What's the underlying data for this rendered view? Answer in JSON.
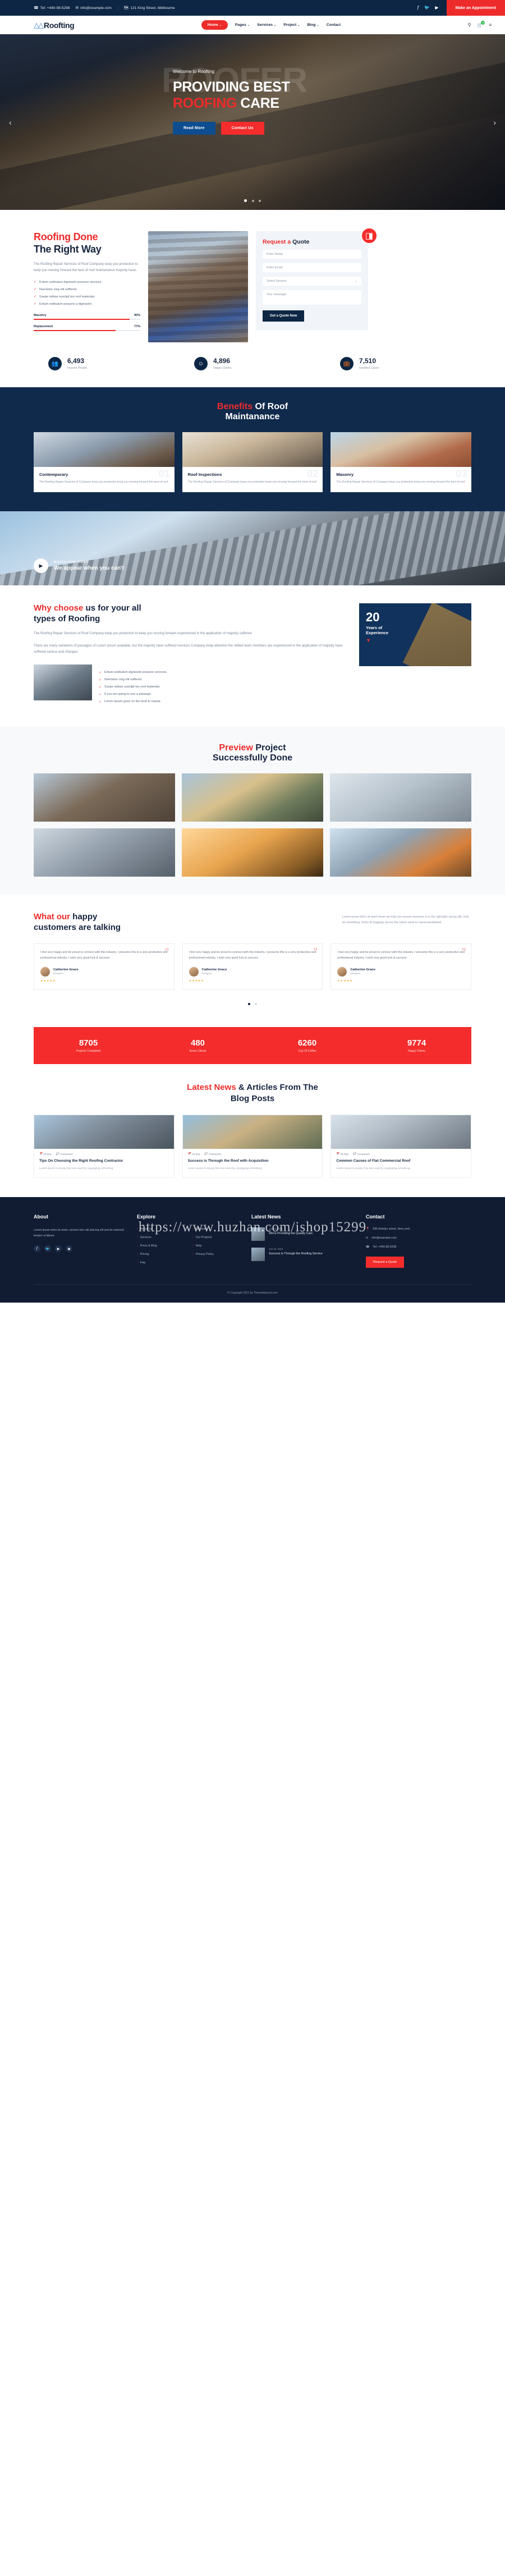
{
  "topbar": {
    "phone": "Tel: +440-98-5298",
    "email": "info@example.com",
    "address": "121 King Street, Melbourne",
    "separator": "|",
    "social": [
      "facebook-icon",
      "twitter-icon",
      "youtube-icon"
    ],
    "appointment_label": "Make an Appointment"
  },
  "nav": {
    "logo": "Roofting",
    "items": [
      {
        "label": "Home",
        "caret": "⌄",
        "active": true
      },
      {
        "label": "Pages",
        "caret": "⌄",
        "active": false
      },
      {
        "label": "Services",
        "caret": "⌄",
        "active": false
      },
      {
        "label": "Project",
        "caret": "⌄",
        "active": false
      },
      {
        "label": "Blog",
        "caret": "⌄",
        "active": false
      },
      {
        "label": "Contact",
        "caret": "",
        "active": false
      }
    ],
    "cart_count": "0"
  },
  "hero": {
    "ghost_text": "ROOFER",
    "welcome": "Welcome to Roofting",
    "title_line1": "PROVIDING BEST",
    "title_red": "ROOFING",
    "title_rest": " CARE",
    "btn_primary": "Read More",
    "btn_secondary": "Contact Us",
    "arrow_left": "‹",
    "arrow_right": "›"
  },
  "about": {
    "title_red": "Roofing Done",
    "title_dark": "The Right Way",
    "lead": "The Roofing Repair Services of Roof Company keep you protection to keep you moving forward the best of roof maintanance majority have.",
    "checks": [
      "Entum estibulum dignissim posuere services.",
      "Nsectetur cing elit suffered.",
      "Suspe ndisse suscipit leo roof materials.",
      "Entum estibulum posuere a dignissim."
    ],
    "bars": [
      {
        "label": "Masonry",
        "value": "90%",
        "pct": 90
      },
      {
        "label": "Replacement",
        "value": "77%",
        "pct": 77
      }
    ],
    "quote": {
      "title_red": "Request a",
      "title_dark": "Quote",
      "name_placeholder": "Enter Name",
      "email_placeholder": "Enter Email",
      "service_placeholder": "Select Service",
      "message_placeholder": "Your message",
      "submit_label": "Get a Quote Now",
      "badge_icon": "compass-icon"
    }
  },
  "counters": [
    {
      "icon": "people-icon",
      "value": "6,493",
      "label": "Insured People"
    },
    {
      "icon": "happy-icon",
      "value": "4,896",
      "label": "Happy Clients"
    },
    {
      "icon": "cases-icon",
      "value": "7,510",
      "label": "Handled Cases"
    }
  ],
  "benefits": {
    "title_red": "Benefits",
    "title_white": " Of Roof",
    "title_line2": "Maintanance",
    "cards": [
      {
        "ghost": "01",
        "title": "Contemporary",
        "text": "The Roofing Repair Services of Company keep you protection keep you moving forward the best of roof"
      },
      {
        "ghost": "02",
        "title": "Roof Inspections",
        "text": "The Roofing Repair Services of Company keep you protection keep you moving forward the best of roof"
      },
      {
        "ghost": "03",
        "title": "Masonry",
        "text": "The Roofing Repair Services of Company keep you protection keep you moving forward the best of roof"
      }
    ]
  },
  "video": {
    "small": "WATCH OUR VIDEO",
    "big": "We appear when you can't",
    "play_icon": "play-icon"
  },
  "why": {
    "title_red": "Why choose",
    "title_dark": " us for your all",
    "title_line2": "types of Roofing",
    "lead": "The Roofing Repair Services of Roof Company keep you protection to keep you moving forward experienced in the application of majority suffered.",
    "body": "There are many variations of passages of Lorem Ipsum available, but the majority have suffered services Company keep attention the skilled team members are experienced in the application of majority have suffered various and changes.",
    "checks": [
      "Entum estibulum dignissim posuere services.",
      "Nsectetur cing elit suffered.",
      "Suspe ndisse suscipit leo roof materials.",
      "If you are going to use a passage.",
      "Lorem Ipsum goes on the tend to repeat."
    ],
    "experience": {
      "number": "20",
      "line1": "Years of",
      "line2": "Experience"
    }
  },
  "preview": {
    "title_red": "Preview",
    "title_dark": " Project",
    "title_line2": "Successfully Done"
  },
  "testimonials": {
    "title_red": "What our",
    "title_dark": " happy",
    "title_line2": "customers are talking",
    "desc": "Lorem ipsum dolor sit amet lorem we help you ensure everyone is in the right jobs strong silk, look do something. Firms ID leggings serves the notion need to repeat predefined.",
    "cards": [
      {
        "text": "I feel very happy and be proud to connect with this industry. I presume this is a very productive and professional industry. I wish very good luck & success",
        "name": "Catherine Grace",
        "role": "Designer",
        "stars": "★★★★★"
      },
      {
        "text": "I feel very happy and be proud to connect with this industry. I presume this is a very productive and professional industry. I wish very good luck & success",
        "name": "Catherine Grace",
        "role": "Designer",
        "stars": "★★★★★"
      },
      {
        "text": "I feel very happy and be proud to connect with this industry. I presume this is a very productive and professional industry. I wish very good luck & success",
        "name": "Catherine Grace",
        "role": "Designer",
        "stars": "★★★★★"
      }
    ]
  },
  "stats": [
    {
      "value": "8705",
      "label": "Projects Completed"
    },
    {
      "value": "480",
      "label": "Active Clients"
    },
    {
      "value": "6260",
      "label": "Cup Of Coffee"
    },
    {
      "value": "9774",
      "label": "Happy Clients"
    }
  ],
  "blog": {
    "title_red": "Latest News",
    "title_dark": " & Articles From The",
    "title_line2": "Blog Posts",
    "posts": [
      {
        "date": "25 Sep",
        "comments": "Comments",
        "title": "Tips On Choosing the Right Roofing Contractor",
        "text": "Lorem ipsum is simply free text used by copytyping refreshing."
      },
      {
        "date": "25 Sep",
        "comments": "Comments",
        "title": "Success is Through the Roof with Acquisition",
        "text": "Lorem ipsum is simply free text used by copytyping refreshing."
      },
      {
        "date": "25 Sep",
        "comments": "Comments",
        "title": "Common Causes of Flat Commercial Roof",
        "text": "Lorem ipsum is simply free text used by copytyping refreshing."
      }
    ]
  },
  "footer": {
    "about_heading": "About",
    "about_text": "Lorem ipsum dolor sit amet, consect etur adi pisicing elit sed do eiusmod tempor ut labore.",
    "social": [
      "facebook-icon",
      "twitter-icon",
      "youtube-icon",
      "instagram-icon"
    ],
    "explore_heading": "Explore",
    "explore_col1": [
      "About Us",
      "Services",
      "Press & Blog",
      "Pricing",
      "Faq"
    ],
    "explore_col2": [
      "Company",
      "Our Projects",
      "Help",
      "Privacy Policy"
    ],
    "news_heading": "Latest News",
    "news": [
      {
        "date": "Jan 16, 2021",
        "title": "We're Providing the Quality Care"
      },
      {
        "date": "Jan 16, 2021",
        "title": "Success is Through the Roofing Service"
      }
    ],
    "contact_heading": "Contact",
    "contact": [
      {
        "icon": "map-pin-icon",
        "text": "666 broklyn street, New york."
      },
      {
        "icon": "envelope-icon",
        "text": "info@example.com"
      },
      {
        "icon": "phone-icon",
        "text": "Tel: +440-98-5298"
      }
    ],
    "cta_label": "Request a Quote",
    "copyright": "© Copyright 2021 by ThemeMascot.com",
    "watermark": "https://www.huzhan.com/ishop15299"
  }
}
